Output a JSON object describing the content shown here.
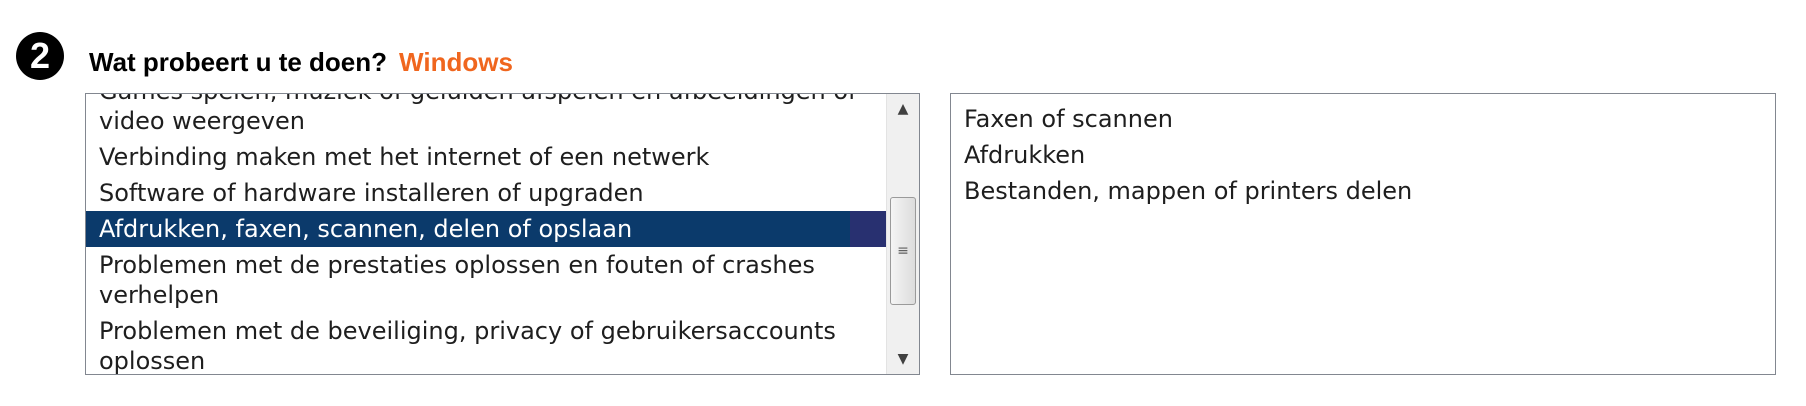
{
  "step": {
    "number": "2",
    "question": "Wat probeert u te doen?",
    "os_label": "Windows"
  },
  "categories": {
    "items": [
      "Games spelen, muziek of geluiden afspelen en afbeeldingen of video weergeven",
      "Verbinding maken met het internet of een netwerk",
      "Software of hardware installeren of upgraden",
      "Afdrukken, faxen, scannen, delen of opslaan",
      "Problemen met de prestaties oplossen en fouten of crashes verhelpen",
      "Problemen met de beveiliging, privacy of gebruikersaccounts oplossen"
    ],
    "selected": "Afdrukken, faxen, scannen, delen of opslaan"
  },
  "scrollbar": {
    "up_glyph": "▲",
    "down_glyph": "▼",
    "grip_glyph": "≡"
  },
  "subtopics": {
    "items": [
      "Faxen of scannen",
      "Afdrukken",
      "Bestanden, mappen of printers delen"
    ]
  }
}
